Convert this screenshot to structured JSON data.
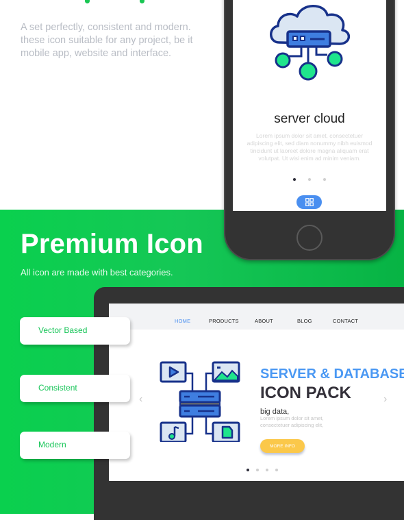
{
  "intro": {
    "text": "A set perfectly, consistent and modern. these icon suitable for any project, be it mobile app, website and interface."
  },
  "phone": {
    "icon": "server-cloud-icon",
    "label": "server cloud",
    "lorem": "Lorem ipsum dolor sit amet, consectetuer adipiscing elit, sed diam nonummy nibh euismod tincidunt ut laoreet dolore magna aliquam erat volutpat. Ut wisi enim ad minim veniam.",
    "pagination": {
      "total": 3,
      "active": 1
    },
    "menu_button_icon": "grid-icon"
  },
  "hero": {
    "title": "Premium Icon",
    "subtitle": "All icon are made with best categories."
  },
  "features": [
    {
      "label": "Vector Based"
    },
    {
      "label": "Consistent"
    },
    {
      "label": "Modern"
    }
  ],
  "website": {
    "nav": [
      {
        "label": "HOME",
        "active": true
      },
      {
        "label": "PRODUCTS",
        "active": false
      },
      {
        "label": "ABOUT",
        "active": false
      },
      {
        "label": "BLOG",
        "active": false
      },
      {
        "label": "CONTACT",
        "active": false
      }
    ],
    "icon": "big-data-server-icon",
    "title_line1": "SERVER & DATABASE",
    "title_line2": "ICON PACK",
    "subtitle": "big data,",
    "lorem": "Lorem ipsum dolor sit amet, consectetuer adipiscing elit,",
    "button": "MORE INFO",
    "pagination": {
      "total": 4,
      "active": 1
    }
  },
  "colors": {
    "green": "#15c756",
    "blue": "#4a98f3",
    "yellow": "#fbc84a",
    "dark": "#333333"
  }
}
